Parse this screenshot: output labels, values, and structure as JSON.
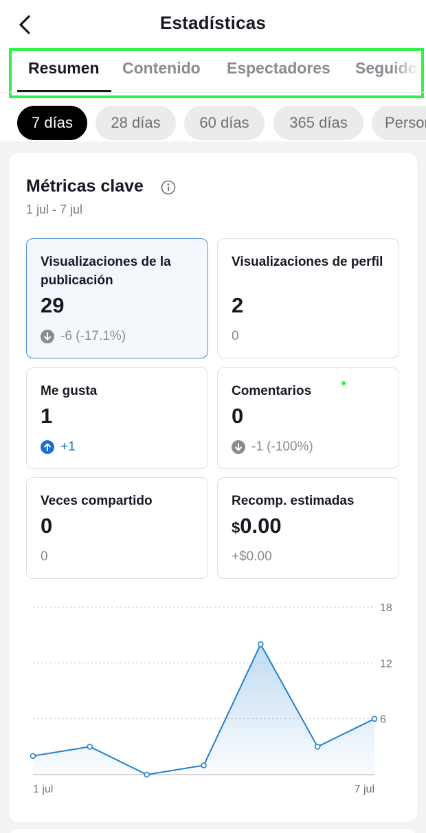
{
  "header": {
    "title": "Estadísticas",
    "back_icon": "chevron-left-icon"
  },
  "tabs": [
    {
      "label": "Resumen",
      "active": true
    },
    {
      "label": "Contenido",
      "active": false
    },
    {
      "label": "Espectadores",
      "active": false
    },
    {
      "label": "Seguidores",
      "active": false
    }
  ],
  "periods": [
    {
      "label": "7 días",
      "active": true
    },
    {
      "label": "28 días",
      "active": false
    },
    {
      "label": "60 días",
      "active": false
    },
    {
      "label": "365 días",
      "active": false
    },
    {
      "label": "Personalizado",
      "active": false
    }
  ],
  "key_metrics": {
    "title": "Métricas clave",
    "info_icon": "info-icon",
    "date_range": "1 jul - 7 jul",
    "cards": [
      {
        "label": "Visualizaciones de la publicación",
        "value": "29",
        "change": "-6 (-17.1%)",
        "trend": "down"
      },
      {
        "label": "Visualizaciones de perfil",
        "value": "2",
        "change": "0",
        "trend": "none"
      },
      {
        "label": "Me gusta",
        "value": "1",
        "change": "+1",
        "trend": "up"
      },
      {
        "label": "Comentarios",
        "value": "0",
        "change": "-1 (-100%)",
        "trend": "down"
      },
      {
        "label": "Veces compartido",
        "value": "0",
        "change": "0",
        "trend": "none"
      },
      {
        "label": "Recomp. estimadas",
        "currency": "$",
        "value": "0.00",
        "change": "+$0.00",
        "trend": "none"
      }
    ]
  },
  "colors": {
    "accent": "#1a6fd1",
    "selected_border": "#4b8ad6",
    "highlight_green": "#2ef24a",
    "line": "#1f7fd0"
  },
  "chart_data": {
    "type": "area",
    "x": [
      "1 jul",
      "2 jul",
      "3 jul",
      "4 jul",
      "5 jul",
      "6 jul",
      "7 jul"
    ],
    "series": [
      {
        "values": [
          2,
          3,
          0,
          1,
          14,
          3,
          6
        ]
      }
    ],
    "x_tick_labels": [
      "1 jul",
      "7 jul"
    ],
    "y_ticks": [
      6,
      12,
      18
    ],
    "ylim": [
      0,
      18
    ],
    "grid": true,
    "y_axis_side": "right"
  }
}
